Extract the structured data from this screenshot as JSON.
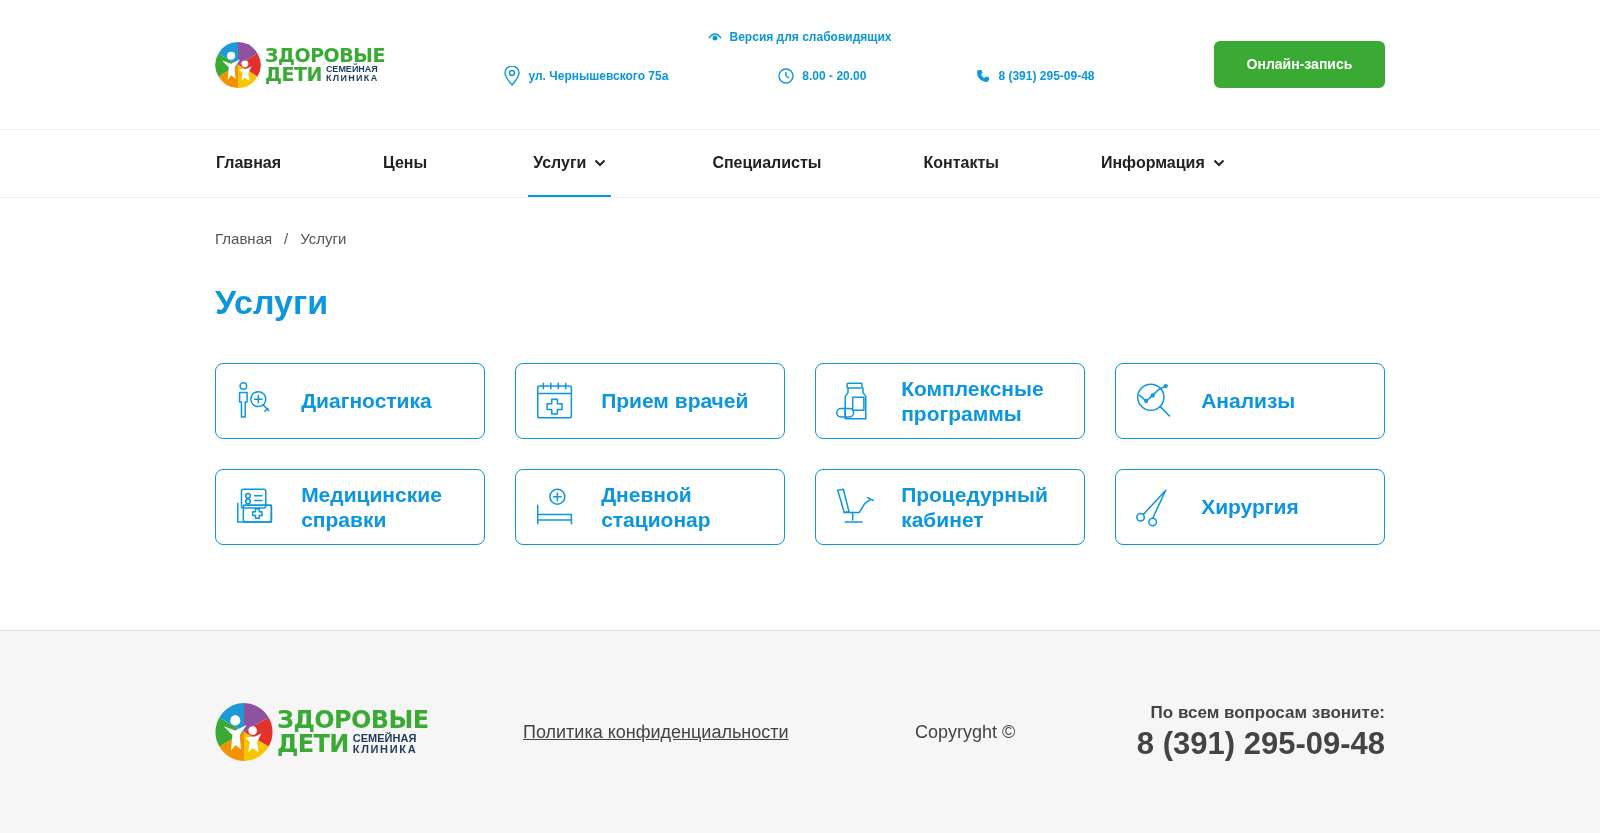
{
  "logo": {
    "line1": "ЗДОРОВЫЕ",
    "line2": "ДЕТИ",
    "subtitle1": "СЕМЕЙНАЯ",
    "subtitle2": "КЛИНИКА"
  },
  "header": {
    "accessibility_link": "Версия для слабовидящих",
    "address": "ул. Чернышевского 75а",
    "hours": "8.00 - 20.00",
    "phone": "8 (391) 295-09-48",
    "cta_button": "Онлайн-запись"
  },
  "nav": [
    {
      "label": "Главная",
      "selected": false,
      "has_menu": false
    },
    {
      "label": "Цены",
      "selected": false,
      "has_menu": false
    },
    {
      "label": "Услуги",
      "selected": true,
      "has_menu": true
    },
    {
      "label": "Специалисты",
      "selected": false,
      "has_menu": false
    },
    {
      "label": "Контакты",
      "selected": false,
      "has_menu": false
    },
    {
      "label": "Информация",
      "selected": false,
      "has_menu": true
    }
  ],
  "breadcrumbs": [
    "Главная",
    "Услуги"
  ],
  "breadcrumb_separator": "/",
  "page_title": "Услуги",
  "services": [
    {
      "label": "Диагностика",
      "kind": "diagnostics"
    },
    {
      "label": "Прием врачей",
      "kind": "calendar"
    },
    {
      "label": "Комплексные программы",
      "kind": "pills"
    },
    {
      "label": "Анализы",
      "kind": "analysis"
    },
    {
      "label": "Медицинские справки",
      "kind": "certificate"
    },
    {
      "label": "Дневной стационар",
      "kind": "bed"
    },
    {
      "label": "Процедурный кабинет",
      "kind": "chair"
    },
    {
      "label": "Хирургия",
      "kind": "scissors"
    }
  ],
  "footer": {
    "logo": {
      "line1": "ЗДОРОВЫЕ",
      "line2": "ДЕТИ",
      "subtitle1": "СЕМЕЙНАЯ",
      "subtitle2": "КЛИНИКА"
    },
    "privacy_link": "Политика конфиденциальности",
    "copyright": "Copyryght ©",
    "call_prompt": "По всем вопросам звоните:",
    "phone": "8 (391) 295-09-48"
  }
}
